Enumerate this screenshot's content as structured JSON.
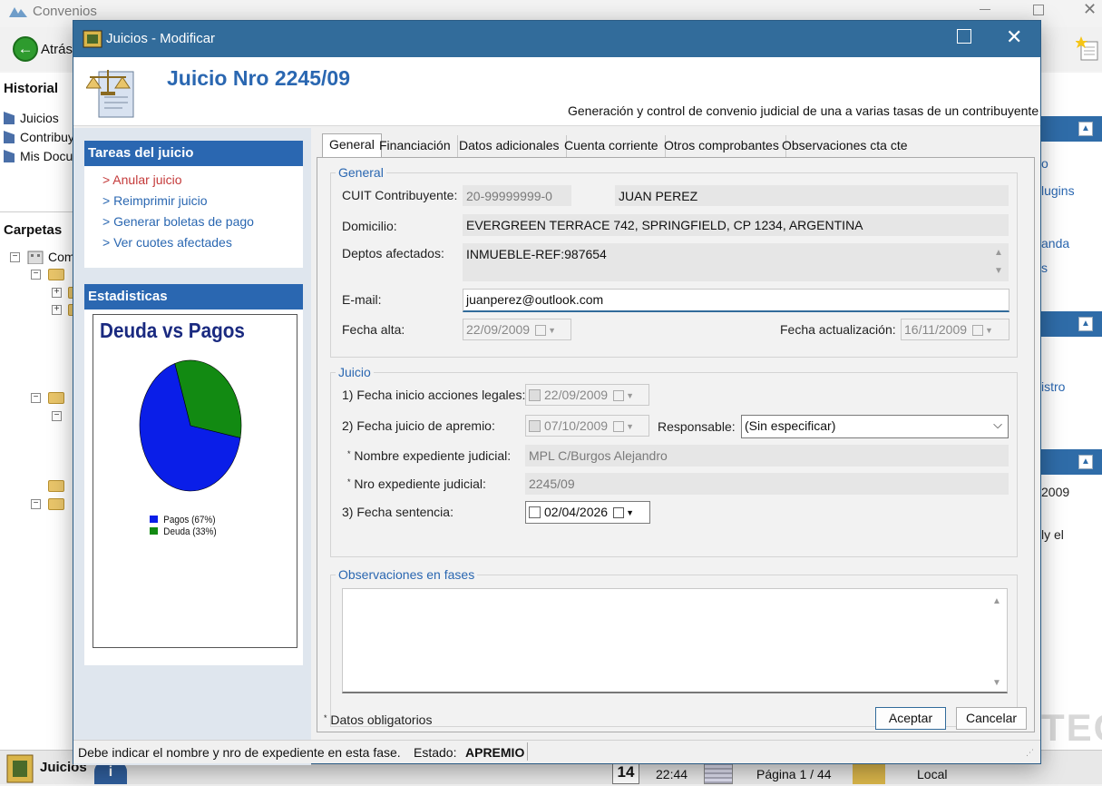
{
  "app": {
    "title": "Convenios",
    "back_label": "Atrás",
    "historial": {
      "title": "Historial",
      "items": [
        "Juicios",
        "Contribuy",
        "Mis Docu"
      ]
    },
    "carpetas": {
      "title": "Carpetas",
      "root_label": "Com"
    },
    "right_panel": {
      "links": [
        "o",
        "lugins",
        "anda",
        "s",
        "istro"
      ],
      "texts": [
        "2009",
        "ly el"
      ]
    },
    "taskbar": {
      "app_label": "Juicios",
      "day": "14",
      "time": "22:44",
      "page": "Página 1 / 44",
      "mode": "Local",
      "watermark": "TEC"
    }
  },
  "dialog": {
    "title": "Juicios - Modificar",
    "header": {
      "title": "Juicio Nro 2245/09",
      "subtitle": "Generación y control de convenio judicial de una a varias tasas de un contribuyente"
    },
    "tareas": {
      "title": "Tareas del juicio",
      "items": [
        "> Anular juicio",
        "> Reimprimir juicio",
        "> Generar boletas de pago",
        "> Ver cuotes afectades"
      ]
    },
    "estadisticas": {
      "title": "Estadisticas",
      "chart_title": "Deuda vs Pagos"
    },
    "tabs": [
      "General",
      "Financiación",
      "Datos adicionales",
      "Cuenta corriente",
      "Otros comprobantes",
      "Observaciones cta cte"
    ],
    "general": {
      "group_title": "General",
      "cuit_label": "CUIT Contribuyente:",
      "cuit_value": "20-99999999-0",
      "nombre_value": "JUAN PEREZ",
      "domicilio_label": "Domicilio:",
      "domicilio_value": "EVERGREEN TERRACE 742, SPRINGFIELD, CP 1234, ARGENTINA",
      "deptos_label": "Deptos afectados:",
      "deptos_value": "INMUEBLE-REF:987654",
      "email_label": "E-mail:",
      "email_value": "juanperez@outlook.com",
      "fecha_alta_label": "Fecha alta:",
      "fecha_alta_value": "22/09/2009",
      "fecha_act_label": "Fecha actualización:",
      "fecha_act_value": "16/11/2009"
    },
    "juicio": {
      "group_title": "Juicio",
      "inicio_label": "1) Fecha inicio acciones legales:",
      "inicio_value": "22/09/2009",
      "apremio_label": "2) Fecha juicio de apremio:",
      "apremio_value": "07/10/2009",
      "responsable_label": "Responsable:",
      "responsable_value": "(Sin especificar)",
      "nombre_exp_label": "Nombre expediente judicial:",
      "nombre_exp_value": "MPL C/Burgos Alejandro",
      "nro_exp_label": "Nro expediente judicial:",
      "nro_exp_value": "2245/09",
      "sentencia_label": "3) Fecha sentencia:",
      "sentencia_value": "02/04/2026"
    },
    "observaciones": {
      "group_title": "Observaciones en fases",
      "value": ""
    },
    "required_note": "Datos obligatorios",
    "buttons": {
      "accept": "Aceptar",
      "cancel": "Cancelar"
    },
    "statusbar": {
      "message": "Debe indicar el nombre y nro de expediente en esta fase.",
      "estado_label": "Estado:",
      "estado_value": "APREMIO"
    }
  },
  "chart_data": {
    "type": "pie",
    "title": "Deuda vs Pagos",
    "categories": [
      "Pagos (67%)",
      "Deuda (33%)"
    ],
    "values": [
      67,
      33
    ],
    "colors": [
      "#0a1ee8",
      "#128a12"
    ],
    "legend": "bottom-left"
  }
}
